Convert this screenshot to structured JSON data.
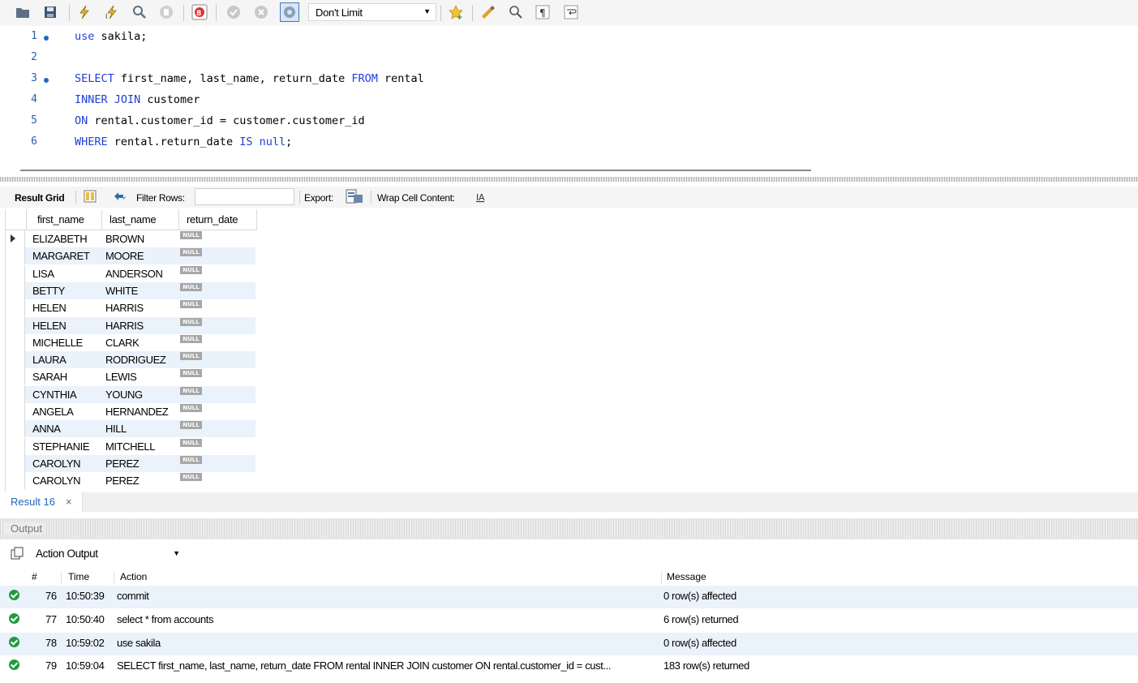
{
  "toolbar": {
    "limit_value": "Don't Limit",
    "icons": [
      "folder-icon",
      "save-icon",
      "execute-icon",
      "execute-current-icon",
      "explain-icon",
      "stop-icon",
      "stop-on-error-icon",
      "commit-icon",
      "rollback-icon",
      "autocommit-icon",
      "beautify-icon",
      "snippet-icon",
      "find-icon",
      "invisible-chars-icon",
      "wrap-icon"
    ]
  },
  "editor": {
    "lines": [
      {
        "num": "1",
        "marker": true,
        "text": "use sakila;"
      },
      {
        "num": "2",
        "marker": false,
        "text": ""
      },
      {
        "num": "3",
        "marker": true,
        "text": "SELECT first_name, last_name, return_date FROM rental"
      },
      {
        "num": "4",
        "marker": false,
        "text": "INNER JOIN customer"
      },
      {
        "num": "5",
        "marker": false,
        "text": "ON rental.customer_id = customer.customer_id"
      },
      {
        "num": "6",
        "marker": false,
        "text": "WHERE rental.return_date IS null;"
      }
    ]
  },
  "result_toolbar": {
    "result_grid_label": "Result Grid",
    "filter_rows_label": "Filter Rows:",
    "filter_value": "",
    "export_label": "Export:",
    "wrap_label": "Wrap Cell Content:"
  },
  "grid": {
    "columns": [
      "first_name",
      "last_name",
      "return_date"
    ],
    "null_label": "NULL",
    "rows": [
      [
        "ELIZABETH",
        "BROWN"
      ],
      [
        "MARGARET",
        "MOORE"
      ],
      [
        "LISA",
        "ANDERSON"
      ],
      [
        "BETTY",
        "WHITE"
      ],
      [
        "HELEN",
        "HARRIS"
      ],
      [
        "HELEN",
        "HARRIS"
      ],
      [
        "MICHELLE",
        "CLARK"
      ],
      [
        "LAURA",
        "RODRIGUEZ"
      ],
      [
        "SARAH",
        "LEWIS"
      ],
      [
        "CYNTHIA",
        "YOUNG"
      ],
      [
        "ANGELA",
        "HERNANDEZ"
      ],
      [
        "ANNA",
        "HILL"
      ],
      [
        "STEPHANIE",
        "MITCHELL"
      ],
      [
        "CAROLYN",
        "PEREZ"
      ],
      [
        "CAROLYN",
        "PEREZ"
      ]
    ]
  },
  "result_tab": {
    "label": "Result 16",
    "close": "×"
  },
  "output": {
    "title": "Output",
    "selector": "Action Output",
    "columns": {
      "num": "#",
      "time": "Time",
      "action": "Action",
      "message": "Message"
    },
    "rows": [
      {
        "num": "76",
        "time": "10:50:39",
        "action": "commit",
        "message": "0 row(s) affected"
      },
      {
        "num": "77",
        "time": "10:50:40",
        "action": "select * from accounts",
        "message": "6 row(s) returned"
      },
      {
        "num": "78",
        "time": "10:59:02",
        "action": "use sakila",
        "message": "0 row(s) affected"
      },
      {
        "num": "79",
        "time": "10:59:04",
        "action": "SELECT first_name, last_name, return_date FROM rental INNER JOIN customer ON rental.customer_id = cust...",
        "message": "183 row(s) returned"
      }
    ]
  }
}
